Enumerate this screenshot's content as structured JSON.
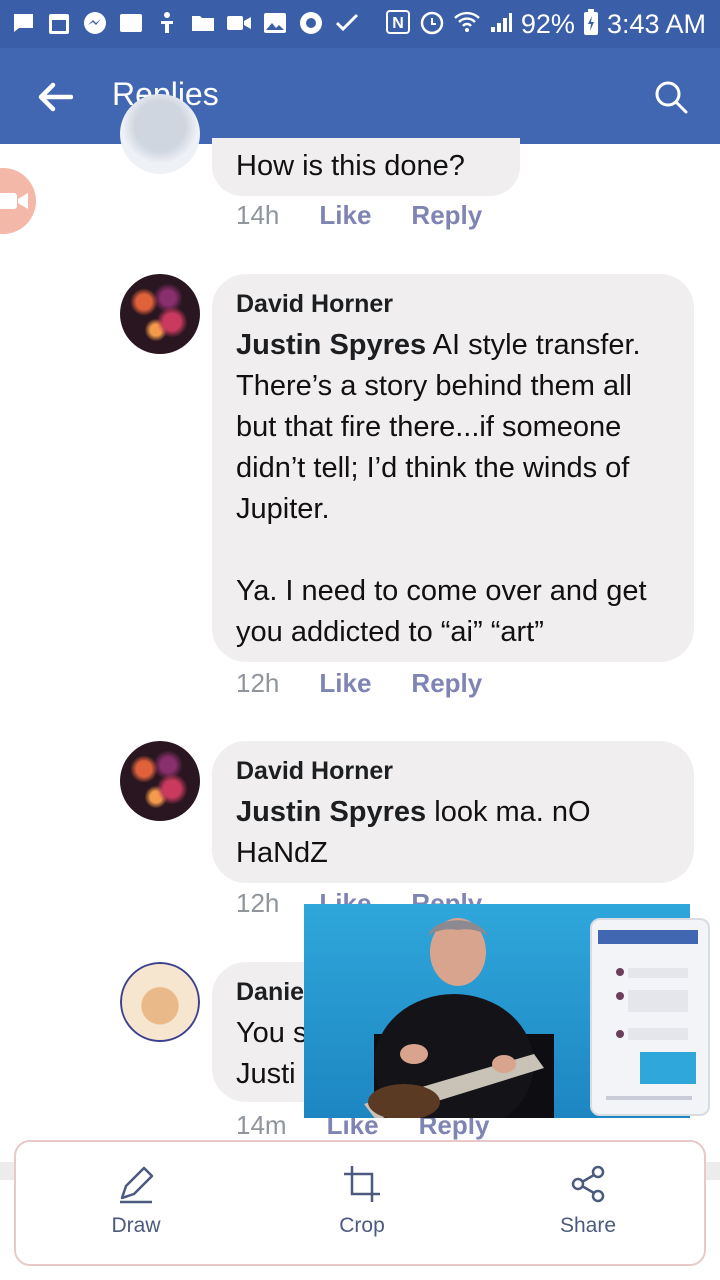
{
  "status_bar": {
    "battery": "92%",
    "time": "3:43 AM"
  },
  "app_bar": {
    "title": "Replies"
  },
  "comments": [
    {
      "author": "",
      "text": "How is this done?",
      "time": "14h",
      "like": "Like",
      "reply": "Reply"
    },
    {
      "author": "David Horner",
      "mention": "Justin Spyres",
      "text": " AI style transfer. There’s a story behind them all but that fire there...if someone didn’t tell; I’d think the winds of Jupiter.\n\nYa. I need to come over and get you addicted to “ai” “art”",
      "time": "12h",
      "like": "Like",
      "reply": "Reply"
    },
    {
      "author": "David Horner",
      "mention": "Justin Spyres",
      "text": " look ma. nO HaNdZ",
      "time": "12h",
      "like": "Like",
      "reply": "Reply"
    },
    {
      "author": "Danie",
      "line1": "You s",
      "line2": "Justi",
      "time": "14m",
      "like": "Like",
      "reply": "Reply"
    }
  ],
  "actions": {
    "draw": "Draw",
    "crop": "Crop",
    "share": "Share"
  },
  "colors": {
    "status_bar": "#3b5ea8",
    "app_bar": "#4267b2",
    "bubble": "#f0eeee",
    "link": "#7e84b3"
  }
}
